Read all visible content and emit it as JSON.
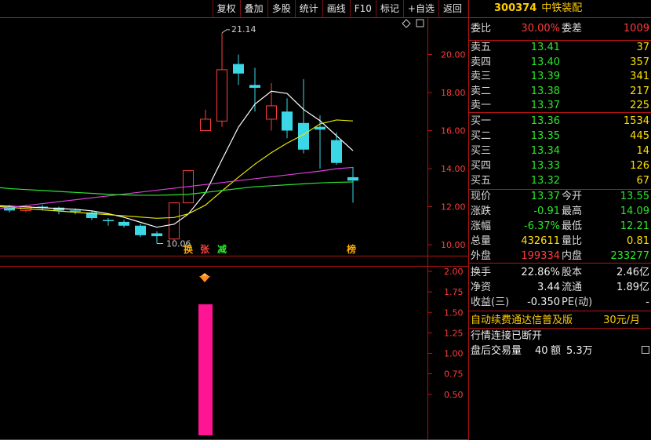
{
  "toolbar": [
    "复权",
    "叠加",
    "多股",
    "统计",
    "画线",
    "F10",
    "标记",
    "+自选",
    "返回"
  ],
  "stock": {
    "code": "300374",
    "name": "中铁装配"
  },
  "price_axis": [
    "20.00",
    "18.00",
    "16.00",
    "14.00",
    "12.00",
    "10.00"
  ],
  "vol_axis": [
    "2.00",
    "1.75",
    "1.50",
    "1.25",
    "1.00",
    "0.75",
    "0.50"
  ],
  "annotations": {
    "high": "21.14",
    "low": "10.06"
  },
  "signals": [
    "换",
    "张",
    "减",
    "榜"
  ],
  "wei": {
    "weibi_label": "委比",
    "weibi": "30.00%",
    "weicha_label": "委差",
    "weicha": "1009"
  },
  "asks": [
    {
      "label": "卖五",
      "price": "13.41",
      "vol": "37"
    },
    {
      "label": "卖四",
      "price": "13.40",
      "vol": "357"
    },
    {
      "label": "卖三",
      "price": "13.39",
      "vol": "341"
    },
    {
      "label": "卖二",
      "price": "13.38",
      "vol": "217"
    },
    {
      "label": "卖一",
      "price": "13.37",
      "vol": "225"
    }
  ],
  "bids": [
    {
      "label": "买一",
      "price": "13.36",
      "vol": "1534"
    },
    {
      "label": "买二",
      "price": "13.35",
      "vol": "445"
    },
    {
      "label": "买三",
      "price": "13.34",
      "vol": "14"
    },
    {
      "label": "买四",
      "price": "13.33",
      "vol": "126"
    },
    {
      "label": "买五",
      "price": "13.32",
      "vol": "67"
    }
  ],
  "quote": [
    {
      "l1": "现价",
      "v1": "13.37",
      "l2": "今开",
      "v2": "13.55"
    },
    {
      "l1": "涨跌",
      "v1": "-0.91",
      "l2": "最高",
      "v2": "14.09"
    },
    {
      "l1": "涨幅",
      "v1": "-6.37%",
      "l2": "最低",
      "v2": "12.21"
    },
    {
      "l1": "总量",
      "v1": "432611",
      "l2": "量比",
      "v2": "0.81"
    },
    {
      "l1": "外盘",
      "v1": "199334",
      "l2": "内盘",
      "v2": "233277"
    }
  ],
  "fund": [
    {
      "l1": "换手",
      "v1": "22.86%",
      "l2": "股本",
      "v2": "2.46亿"
    },
    {
      "l1": "净资",
      "v1": "3.44",
      "l2": "流通",
      "v2": "1.89亿"
    },
    {
      "l1": "收益(三)",
      "v1": "-0.350",
      "l2": "PE(动)",
      "v2": "-"
    }
  ],
  "ad": {
    "text": "自动续费通达信普及版",
    "price": "30元/月"
  },
  "status": "行情连接已断开",
  "after": {
    "label": "盘后交易量",
    "vol": "40",
    "amt_label": "额",
    "amt": "5.3万"
  },
  "colors": {
    "up": "#ff3c3c",
    "down": "#3cd7e6",
    "ma5": "#ffffff",
    "ma10": "#e6e600",
    "ma20": "#e040e0",
    "ma60": "#2ce62c",
    "volume": "#ff1493"
  }
}
